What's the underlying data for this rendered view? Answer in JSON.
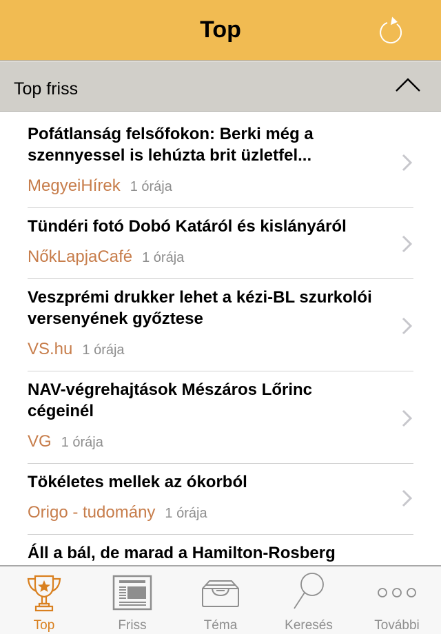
{
  "navbar": {
    "title": "Top",
    "refresh_icon": "refresh-icon",
    "background_color": "#f1bb52"
  },
  "section": {
    "title": "Top friss",
    "toggle_icon": "chevron-up-icon"
  },
  "articles": [
    {
      "headline": "Pofátlanság felsőfokon: Berki még a szennyessel is lehúzta brit üzletfel...",
      "source": "MegyeiHírek",
      "time": "1 órája"
    },
    {
      "headline": "Tündéri fotó Dobó Katáról és kislányáról",
      "source": "NőkLapjaCafé",
      "time": "1 órája"
    },
    {
      "headline": "Veszprémi drukker lehet a kézi-BL szurkolói versenyének győztese",
      "source": "VS.hu",
      "time": "1 órája"
    },
    {
      "headline": "NAV-végrehajtások Mészáros Lőrinc cégeinél",
      "source": "VG",
      "time": "1 órája"
    },
    {
      "headline": "Tökéletes mellek az ókorból",
      "source": "Origo - tudomány",
      "time": "1 órája"
    },
    {
      "headline": "Áll a bál, de marad a Hamilton-Rosberg",
      "source": "",
      "time": ""
    }
  ],
  "tabbar": {
    "active_color": "#d9801f",
    "inactive_color": "#8e8e8e",
    "tabs": [
      {
        "label": "Top",
        "icon": "trophy-icon",
        "active": true
      },
      {
        "label": "Friss",
        "icon": "newspaper-icon",
        "active": false
      },
      {
        "label": "Téma",
        "icon": "inbox-tray-icon",
        "active": false
      },
      {
        "label": "Keresés",
        "icon": "search-icon",
        "active": false
      },
      {
        "label": "További",
        "icon": "more-icon",
        "active": false
      }
    ]
  },
  "colors": {
    "source_text": "#c77d4b",
    "time_text": "#8e8e8e",
    "section_bg": "#d1cfc9"
  }
}
